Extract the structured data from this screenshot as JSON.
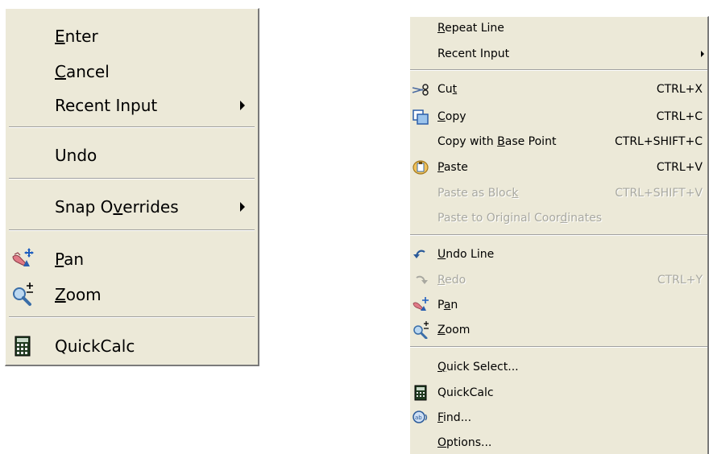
{
  "menu_left": {
    "items": [
      {
        "label": "Enter",
        "mnemonic": "E"
      },
      {
        "label": "Cancel",
        "mnemonic": "C"
      },
      {
        "label": "Recent Input",
        "submenu": true
      },
      {
        "label": "Undo"
      },
      {
        "label": "Snap Overrides",
        "mnemonic": "v",
        "submenu": true
      },
      {
        "label": "Pan",
        "mnemonic": "P",
        "icon": "pan-icon"
      },
      {
        "label": "Zoom",
        "mnemonic": "Z",
        "icon": "zoom-icon"
      },
      {
        "label": "QuickCalc",
        "icon": "calculator-icon"
      }
    ]
  },
  "menu_right": {
    "items": [
      {
        "label": "Repeat Line",
        "mnemonic": "R"
      },
      {
        "label": "Recent Input",
        "submenu": true
      },
      {
        "label": "Cut",
        "mnemonic": "t",
        "shortcut": "CTRL+X",
        "icon": "scissors-icon"
      },
      {
        "label": "Copy",
        "mnemonic": "C",
        "shortcut": "CTRL+C",
        "icon": "copy-icon"
      },
      {
        "label": "Copy with Base Point",
        "mnemonic": "B",
        "shortcut": "CTRL+SHIFT+C"
      },
      {
        "label": "Paste",
        "mnemonic": "P",
        "shortcut": "CTRL+V",
        "icon": "paste-icon"
      },
      {
        "label": "Paste as Block",
        "mnemonic": "k",
        "shortcut": "CTRL+SHIFT+V",
        "disabled": true
      },
      {
        "label": "Paste to Original Coordinates",
        "mnemonic": "d",
        "disabled": true
      },
      {
        "label": "Undo Line",
        "mnemonic": "U",
        "icon": "undo-icon"
      },
      {
        "label": "Redo",
        "mnemonic": "R",
        "shortcut": "CTRL+Y",
        "disabled": true,
        "icon": "redo-icon"
      },
      {
        "label": "Pan",
        "mnemonic": "a",
        "icon": "pan-icon"
      },
      {
        "label": "Zoom",
        "mnemonic": "Z",
        "icon": "zoom-icon"
      },
      {
        "label": "Quick Select...",
        "mnemonic": "Q"
      },
      {
        "label": "QuickCalc",
        "icon": "calculator-icon"
      },
      {
        "label": "Find...",
        "mnemonic": "F",
        "icon": "find-icon"
      },
      {
        "label": "Options...",
        "mnemonic": "O"
      }
    ]
  },
  "colors": {
    "menu_bg": "#ece9d8",
    "disabled_text": "#a8a8a0",
    "separator": "#a0a0a0"
  }
}
